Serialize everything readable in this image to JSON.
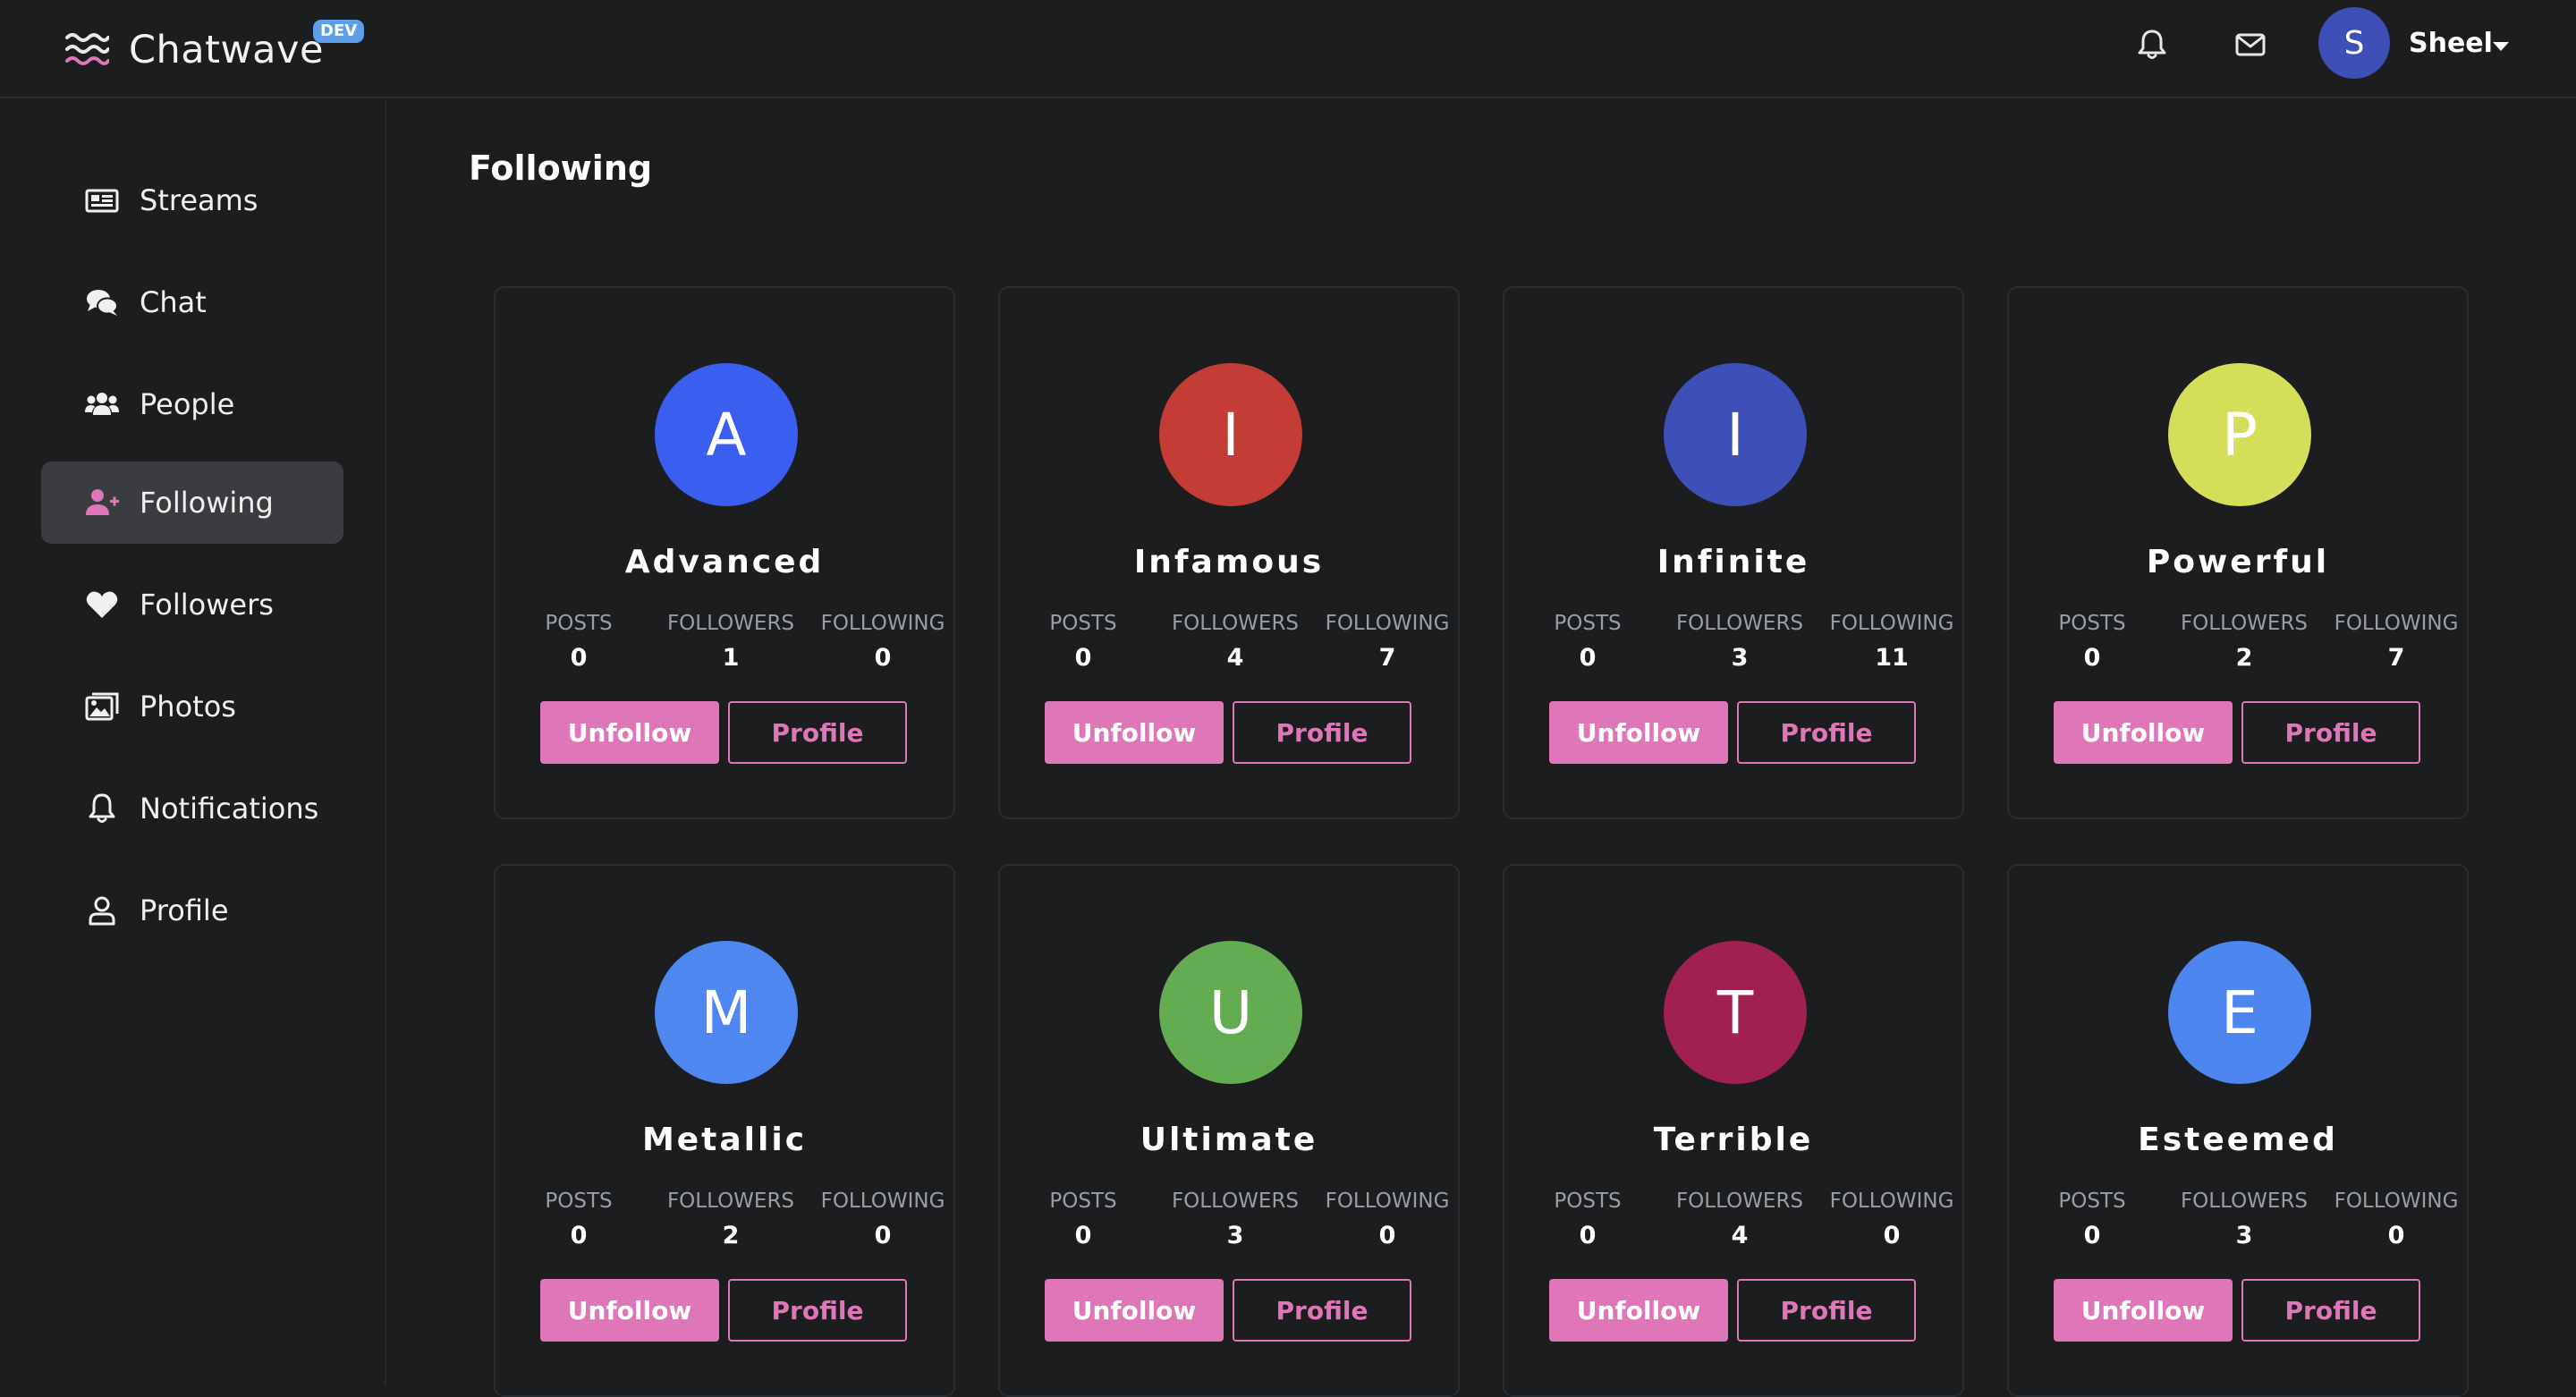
{
  "app": {
    "name": "Chatwave",
    "badge": "DEV"
  },
  "header": {
    "bell_icon": "bell-icon",
    "mail_icon": "envelope-icon",
    "user": {
      "initial": "S",
      "name": "Sheel",
      "avatar_color": "#3f4fb8"
    }
  },
  "sidebar": {
    "items": [
      {
        "label": "Streams",
        "icon": "newspaper-icon",
        "active": false
      },
      {
        "label": "Chat",
        "icon": "comments-icon",
        "active": false
      },
      {
        "label": "People",
        "icon": "users-icon",
        "active": false
      },
      {
        "label": "Following",
        "icon": "user-plus-icon",
        "active": true
      },
      {
        "label": "Followers",
        "icon": "heart-icon",
        "active": false
      },
      {
        "label": "Photos",
        "icon": "images-icon",
        "active": false
      },
      {
        "label": "Notifications",
        "icon": "bell-icon",
        "active": false
      },
      {
        "label": "Profile",
        "icon": "user-icon",
        "active": false
      }
    ]
  },
  "main": {
    "title": "Following",
    "stat_labels": {
      "posts": "POSTS",
      "followers": "FOLLOWERS",
      "following": "FOLLOWING"
    },
    "button_labels": {
      "unfollow": "Unfollow",
      "profile": "Profile"
    },
    "users": [
      {
        "initial": "A",
        "name": "Advanced",
        "color": "#3a5ff0",
        "posts": "0",
        "followers": "1",
        "following": "0"
      },
      {
        "initial": "I",
        "name": "Infamous",
        "color": "#c43c36",
        "posts": "0",
        "followers": "4",
        "following": "7"
      },
      {
        "initial": "I",
        "name": "Infinite",
        "color": "#3f4fb8",
        "posts": "0",
        "followers": "3",
        "following": "11"
      },
      {
        "initial": "P",
        "name": "Powerful",
        "color": "#d4de58",
        "posts": "0",
        "followers": "2",
        "following": "7"
      },
      {
        "initial": "M",
        "name": "Metallic",
        "color": "#4f87f0",
        "posts": "0",
        "followers": "2",
        "following": "0"
      },
      {
        "initial": "U",
        "name": "Ultimate",
        "color": "#63ac52",
        "posts": "0",
        "followers": "3",
        "following": "0"
      },
      {
        "initial": "T",
        "name": "Terrible",
        "color": "#a0204f",
        "posts": "0",
        "followers": "4",
        "following": "0"
      },
      {
        "initial": "E",
        "name": "Esteemed",
        "color": "#4d86ee",
        "posts": "0",
        "followers": "3",
        "following": "0"
      }
    ]
  },
  "colors": {
    "accent": "#de76b7",
    "background": "#1b1d1f",
    "active_nav": "#3a3c3f"
  }
}
